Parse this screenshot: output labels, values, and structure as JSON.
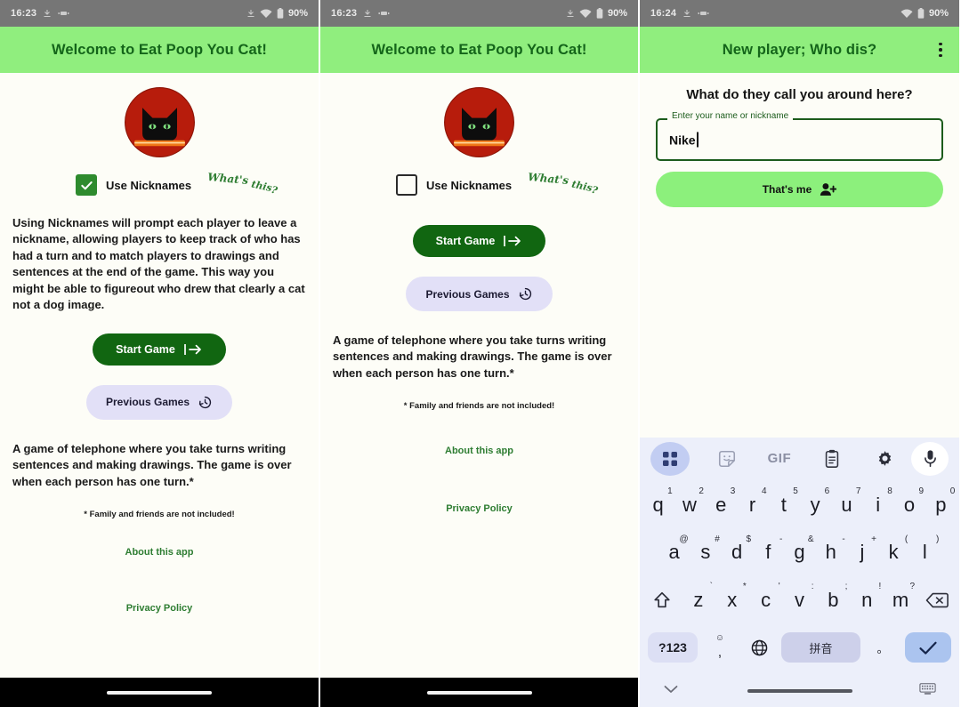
{
  "screens": [
    {
      "id": "screen-1-nicknames-on",
      "statusbar": {
        "clock": "16:23",
        "battery": "90%",
        "icons": [
          "location-icon",
          "vibrate-icon",
          "wifi-icon",
          "battery-icon"
        ]
      },
      "appbar": {
        "title": "Welcome to Eat Poop You Cat!",
        "has_overflow": false
      },
      "logo": {
        "name": "cat-logo",
        "circle_color": "#b71c0c",
        "cat_color": "#111111",
        "bar_color": "#f07818"
      },
      "checkbox": {
        "label": "Use Nicknames",
        "checked": true,
        "hint": "What's this?"
      },
      "explanation": "Using Nicknames will prompt each player to leave a nickname, allowing players to keep track of who has had a turn and to match players to drawings and sentences at the end of the game. This way you might be able to figureout who drew that clearly a cat not a dog image.",
      "start_button": "Start Game",
      "previous_button": "Previous Games",
      "description": "A game of telephone where you take turns writing sentences and making drawings. The game is over when each person has one turn.*",
      "footnote": "* Family and friends are not included!",
      "about_link": "About this app",
      "privacy_link": "Privacy Policy"
    },
    {
      "id": "screen-2-nicknames-off",
      "statusbar": {
        "clock": "16:23",
        "battery": "90%",
        "icons": [
          "location-icon",
          "vibrate-icon",
          "wifi-icon",
          "battery-icon"
        ]
      },
      "appbar": {
        "title": "Welcome to Eat Poop You Cat!",
        "has_overflow": false
      },
      "checkbox": {
        "label": "Use Nicknames",
        "checked": false,
        "hint": "What's this?"
      },
      "start_button": "Start Game",
      "previous_button": "Previous Games",
      "description": "A game of telephone where you take turns writing sentences and making drawings. The game is over when each person has one turn.*",
      "footnote": "* Family and friends are not included!",
      "about_link": "About this app",
      "privacy_link": "Privacy Policy"
    },
    {
      "id": "screen-3-new-player",
      "statusbar": {
        "clock": "16:24",
        "battery": "90%",
        "icons": [
          "location-icon",
          "vibrate-icon",
          "wifi-icon",
          "battery-icon"
        ]
      },
      "appbar": {
        "title": "New player; Who dis?",
        "has_overflow": true
      },
      "prompt": "What do they call you around here?",
      "field": {
        "legend": "Enter your name or nickname",
        "value": "Nike",
        "placeholder": "Enter your name or nickname"
      },
      "submit_button": "That's me"
    }
  ],
  "keyboard": {
    "toolbar": [
      {
        "name": "apps-grid-icon",
        "label": "",
        "active": true
      },
      {
        "name": "sticker-icon",
        "label": ""
      },
      {
        "name": "gif-icon",
        "label": "GIF"
      },
      {
        "name": "clipboard-icon",
        "label": ""
      },
      {
        "name": "gear-icon",
        "label": ""
      },
      {
        "name": "mic-icon",
        "label": ""
      }
    ],
    "row1": [
      {
        "key": "q",
        "sub": "1"
      },
      {
        "key": "w",
        "sub": "2"
      },
      {
        "key": "e",
        "sub": "3"
      },
      {
        "key": "r",
        "sub": "4"
      },
      {
        "key": "t",
        "sub": "5"
      },
      {
        "key": "y",
        "sub": "6"
      },
      {
        "key": "u",
        "sub": "7"
      },
      {
        "key": "i",
        "sub": "8"
      },
      {
        "key": "o",
        "sub": "9"
      },
      {
        "key": "p",
        "sub": "0"
      }
    ],
    "row2": [
      {
        "key": "a",
        "sub": "@"
      },
      {
        "key": "s",
        "sub": "#"
      },
      {
        "key": "d",
        "sub": "$"
      },
      {
        "key": "f",
        "sub": "-"
      },
      {
        "key": "g",
        "sub": "&"
      },
      {
        "key": "h",
        "sub": "-"
      },
      {
        "key": "j",
        "sub": "+"
      },
      {
        "key": "k",
        "sub": "("
      },
      {
        "key": "l",
        "sub": ")"
      }
    ],
    "row3": [
      {
        "key": "z",
        "sub": "`"
      },
      {
        "key": "x",
        "sub": "*"
      },
      {
        "key": "c",
        "sub": "'"
      },
      {
        "key": "v",
        "sub": ":"
      },
      {
        "key": "b",
        "sub": ";"
      },
      {
        "key": "n",
        "sub": "!"
      },
      {
        "key": "m",
        "sub": "?"
      }
    ],
    "shift_key": "shift-icon",
    "backspace_key": "backspace-icon",
    "row4": {
      "symbols_key": "?123",
      "emoji_key": "☺",
      "comma_key": ",",
      "language_key": "globe-icon",
      "space_key": "拼音",
      "period_key": "。",
      "enter_key": "check-icon"
    },
    "navbar": {
      "collapse": "chevron-down-icon",
      "keyboard_switch": "keyboard-icon"
    }
  },
  "colors": {
    "appbar_green": "#90ee7e",
    "title_green": "#14651a",
    "start_button_green": "#116611",
    "previous_button_lavender": "#e2e0f7",
    "link_green": "#2e7d32",
    "submit_green": "#8cf07c",
    "keyboard_bg": "#eceffa",
    "enter_blue": "#abc4ef",
    "statusbar_gray": "#767676"
  }
}
